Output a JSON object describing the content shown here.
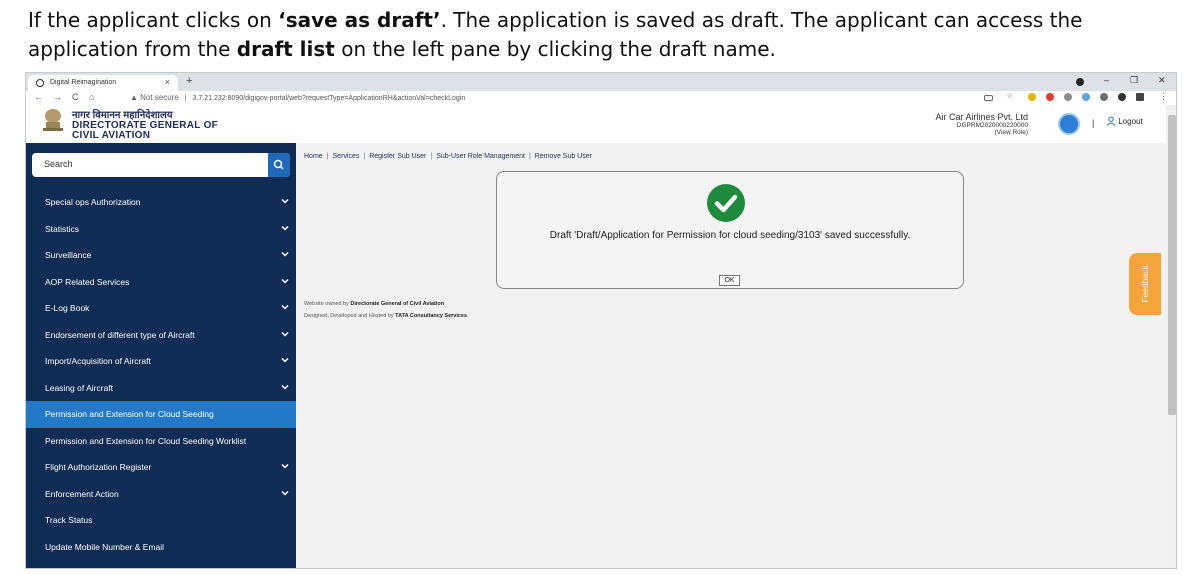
{
  "caption": {
    "p1": "If the applicant clicks on ",
    "b1": "‘save as draft’",
    "p2": ". The application is saved as draft. The applicant can access the application from the ",
    "b2": "draft list",
    "p3": " on the left pane by clicking the draft name."
  },
  "browser": {
    "tab_title": "Digital Reimagination",
    "tab_close": "×",
    "new_tab": "+",
    "window_controls": [
      "–",
      "❐",
      "✕"
    ],
    "nav": {
      "back": "←",
      "forward": "→",
      "reload": "C",
      "home": "⌂"
    },
    "url_warning": "▲ Not secure",
    "url": "3.7.21.232:8090/digigov-portal/web?requestType=ApplicationRH&actionVal=checkLogin",
    "menu_dots": "⋮"
  },
  "header": {
    "hindi_title": "नागर विमानन महानिदेशालय",
    "org_line1": "DIRECTORATE GENERAL OF",
    "org_line2": "CIVIL AVIATION",
    "company": "Air Car Airlines Pvt. Ltd",
    "company_id": "DGPRM2020000220000",
    "view_role": "(View Role)",
    "separator": "|",
    "logout": "Logout"
  },
  "sidebar": {
    "search_placeholder": "Search",
    "items": [
      {
        "label": "Special ops Authorization",
        "chevron": true
      },
      {
        "label": "Statistics",
        "chevron": true
      },
      {
        "label": "Surveillance",
        "chevron": true
      },
      {
        "label": "AOP Related Services",
        "chevron": true
      },
      {
        "label": "E-Log Book",
        "chevron": true
      },
      {
        "label": "Endorsement of different type of Aircraft",
        "chevron": true
      },
      {
        "label": "Import/Acquisition of Aircraft",
        "chevron": true
      },
      {
        "label": "Leasing of Aircraft",
        "chevron": true
      },
      {
        "label": "Permission and Extension for Cloud Seeding",
        "chevron": false,
        "active": true
      },
      {
        "label": "Permission and Extension for Cloud Seeding Worklist",
        "chevron": false
      },
      {
        "label": "Flight Authorization Register",
        "chevron": true
      },
      {
        "label": "Enforcement Action",
        "chevron": true
      },
      {
        "label": "Track Status",
        "chevron": false
      },
      {
        "label": "Update Mobile Number & Email",
        "chevron": false
      }
    ]
  },
  "breadcrumbs": [
    "Home",
    "Services",
    "Register Sub User",
    "Sub-User Role Management",
    "Remove Sub User"
  ],
  "breadcrumb_sep": "|",
  "dialog": {
    "message": "Draft 'Draft/Application for Permission for cloud seeding/3103' saved successfully.",
    "ok_label": "OK"
  },
  "footer": {
    "line1_prefix": "Website owned by ",
    "line1_bold": "Directorate General of Civil Aviation",
    "line2_prefix": "Designed, Developed and Hosted by ",
    "line2_bold": "TATA Consultancy Services"
  },
  "feedback_label": "Feedback",
  "colors": {
    "sidebar_bg": "#0f2c54",
    "sidebar_active": "#2179c7",
    "search_button": "#1e6ab8",
    "success_green": "#1e8a3c",
    "feedback_orange": "#f5a43a",
    "content_bg": "#f2f2f2"
  }
}
